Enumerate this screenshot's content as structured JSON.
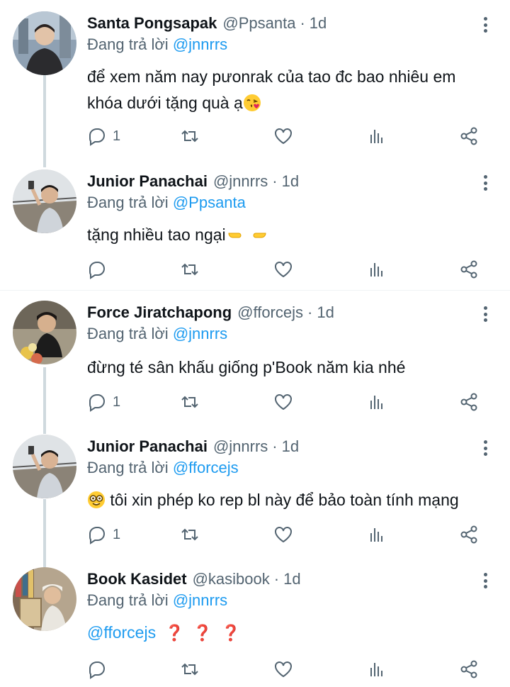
{
  "reply_prefix": "Đang trả lời",
  "tweets": [
    {
      "name": "Santa Pongsapak",
      "handle": "@Ppsanta",
      "dot": "·",
      "time": "1d",
      "reply_to": "@jnnrrs",
      "text_line1": "để xem năm nay pưonrak của tao đc bao nhiêu em",
      "text_line2": "khóa dưới tặng quà ạ",
      "emoji": "face-blowing-kiss",
      "reply_count": "1"
    },
    {
      "name": "Junior Panachai",
      "handle": "@jnnrrs",
      "dot": "·",
      "time": "1d",
      "reply_to": "@Ppsanta",
      "text_line1": "tặng nhiều tao ngại",
      "emoji": "pointing-hands",
      "reply_count": ""
    },
    {
      "name": "Force Jiratchapong",
      "handle": "@fforcejs",
      "dot": "·",
      "time": "1d",
      "reply_to": "@jnnrrs",
      "text_line1": "đừng té sân khấu giống p'Book năm kia nhé",
      "reply_count": "1"
    },
    {
      "name": "Junior Panachai",
      "handle": "@jnnrrs",
      "dot": "·",
      "time": "1d",
      "reply_to": "@fforcejs",
      "text_line1": "tôi xin phép ko rep bl này để bảo toàn tính mạng",
      "emoji": "nerd-face",
      "reply_count": "1"
    },
    {
      "name": "Book Kasidet",
      "handle": "@kasibook",
      "dot": "·",
      "time": "1d",
      "reply_to": "@jnnrrs",
      "text_mention": "@fforcejs",
      "text_marks": [
        "❓",
        "❓",
        "❓"
      ],
      "reply_count": ""
    }
  ],
  "icons": {
    "reply": "reply-icon",
    "retweet": "retweet-icon",
    "like": "like-icon",
    "views": "views-icon",
    "share": "share-icon",
    "more": "more-icon"
  },
  "colors": {
    "link": "#1d9bf0",
    "secondary_text": "#536471",
    "thread_line": "#cfd9de"
  }
}
